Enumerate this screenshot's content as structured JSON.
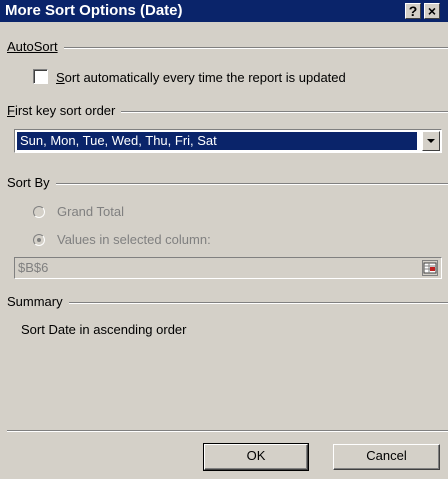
{
  "window": {
    "title": "More Sort Options (Date)",
    "help_label": "?",
    "close_label": "×"
  },
  "autosort": {
    "group_label": "AutoSort",
    "checkbox_label_mnemonic": "S",
    "checkbox_label_rest": "ort automatically every time the report is updated",
    "checked": false
  },
  "first_key": {
    "group_label_mnemonic": "F",
    "group_label_rest": "irst key sort order",
    "selected_value": "Sun, Mon, Tue, Wed, Thu, Fri, Sat"
  },
  "sort_by": {
    "group_label": "Sort By",
    "options": [
      {
        "label": "Grand Total",
        "selected": false
      },
      {
        "label": "Values in selected column:",
        "selected": true
      }
    ],
    "reference_value": "$B$6"
  },
  "summary": {
    "group_label": "Summary",
    "text": "Sort Date in ascending order"
  },
  "buttons": {
    "ok": "OK",
    "cancel": "Cancel"
  }
}
